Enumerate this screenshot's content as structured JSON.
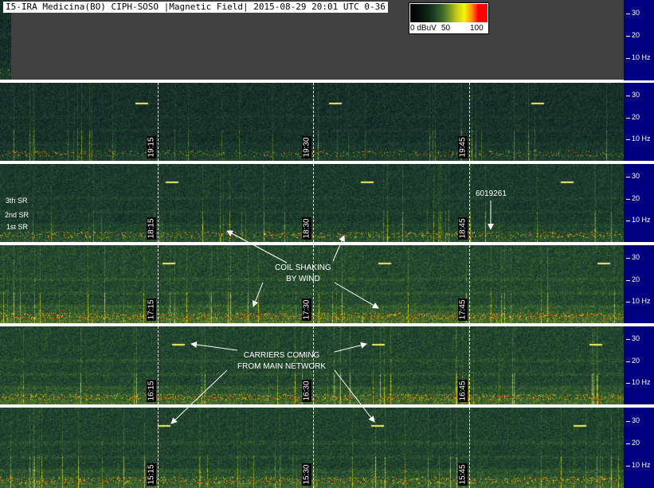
{
  "title": "I5-IRA Medicina(BO) CIPH-SOSO |Magnetic Field| 2015-08-29 20:01 UTC 0-36",
  "colorbar": {
    "min_label": "0 dBuV",
    "mid_label": "50",
    "max_label": "100"
  },
  "chart_data": {
    "type": "heatmap",
    "title": "I5-IRA Medicina(BO) CIPH-SOSO |Magnetic Field| 2015-08-29 20:01 UTC 0-36",
    "ylabel": "Hz",
    "ylim": [
      0,
      36
    ],
    "y_ticks": [
      "30",
      "20",
      "10 Hz"
    ],
    "colorbar_range": [
      0,
      100
    ],
    "strips": [
      {
        "time_labels": []
      },
      {
        "time_labels": [
          "19:15",
          "19:30",
          "19:45"
        ]
      },
      {
        "time_labels": [
          "18:15",
          "18:30",
          "18:45"
        ]
      },
      {
        "time_labels": [
          "17:15",
          "17:30",
          "17:45"
        ]
      },
      {
        "time_labels": [
          "16:15",
          "16:30",
          "16:45"
        ]
      },
      {
        "time_labels": [
          "15:15",
          "15:30",
          "15:45"
        ]
      }
    ],
    "annotations": {
      "coil": "COIL SHAKING\nBY WIND",
      "carriers": "CARRIERS COMING\nFROM MAIN NETWORK",
      "id": "6019261",
      "sr3": "3th SR",
      "sr2": "2nd SR",
      "sr1": "1st SR"
    }
  }
}
